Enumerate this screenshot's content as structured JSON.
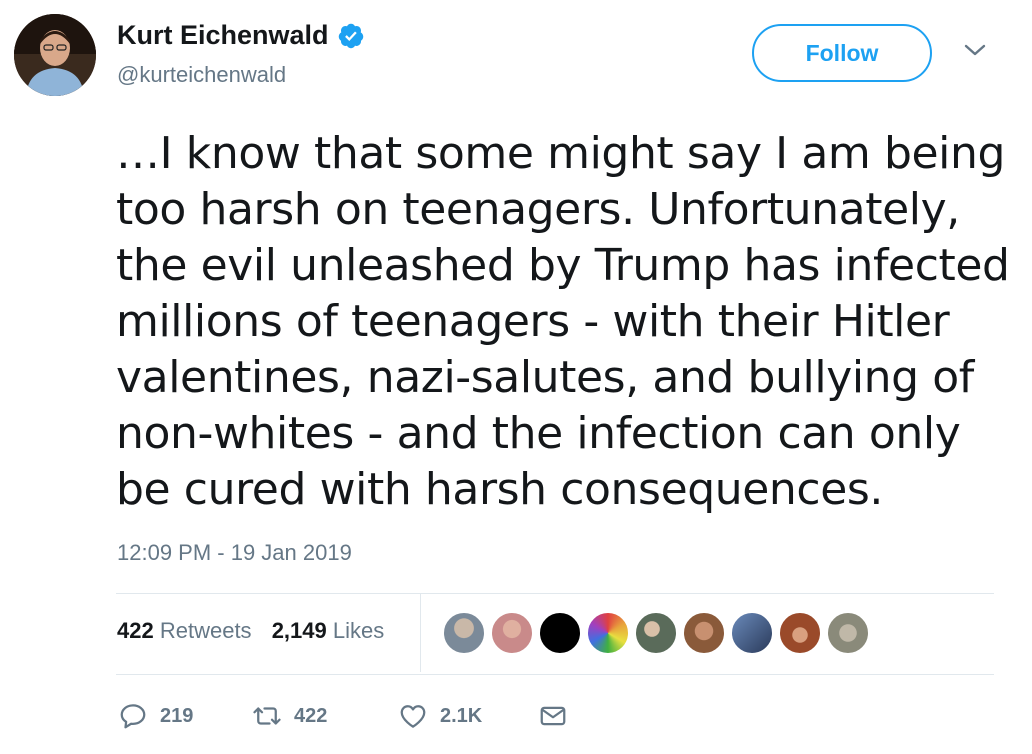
{
  "user": {
    "name": "Kurt Eichenwald",
    "handle": "@kurteichenwald",
    "verified_icon": "verified-badge-icon",
    "avatar_icon": "avatar"
  },
  "follow_label": "Follow",
  "tweet": {
    "text": "…I know that some might say I am being\ntoo harsh on teenagers. Unfortunately,\nthe evil unleashed by Trump has infected\nmillions of teenagers - with their Hitler\nvalentines, nazi-salutes, and bullying of\nnon-whites - and the infection can only\nbe cured with harsh consequences.",
    "timestamp": "12:09 PM - 19 Jan 2019"
  },
  "stats": {
    "retweets_count": "422",
    "retweets_label": "Retweets",
    "likes_count": "2,149",
    "likes_label": "Likes"
  },
  "likers": [
    {
      "icon": "liker-avatar-1",
      "color": "#7b8a99"
    },
    {
      "icon": "liker-avatar-2",
      "color": "#c98a8a"
    },
    {
      "icon": "liker-avatar-3",
      "color": "#000000"
    },
    {
      "icon": "liker-avatar-4",
      "color": "#e8a33d"
    },
    {
      "icon": "liker-avatar-5",
      "color": "#5a6b5a"
    },
    {
      "icon": "liker-avatar-6",
      "color": "#8a5a3a"
    },
    {
      "icon": "liker-avatar-7",
      "color": "#4a6a9a"
    },
    {
      "icon": "liker-avatar-8",
      "color": "#9a4a2a"
    },
    {
      "icon": "liker-avatar-9",
      "color": "#8a8a7a"
    }
  ],
  "actions": {
    "reply_count": "219",
    "retweet_count": "422",
    "like_count": "2.1K",
    "reply_icon": "reply-icon",
    "retweet_icon": "retweet-icon",
    "like_icon": "heart-icon",
    "dm_icon": "envelope-icon"
  },
  "colors": {
    "accent": "#1da1f2",
    "secondary_text": "#657786",
    "divider": "#e1e8ed"
  }
}
